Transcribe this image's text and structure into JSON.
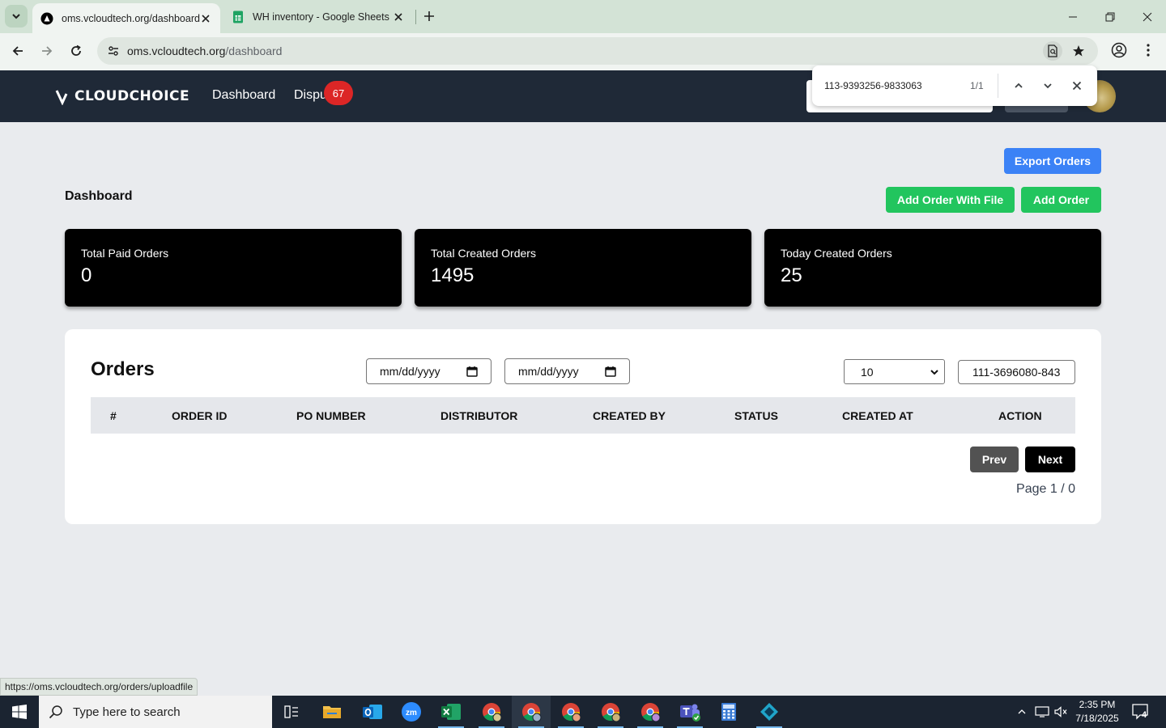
{
  "browser": {
    "tabs": [
      {
        "title": "oms.vcloudtech.org/dashboard",
        "active": true
      },
      {
        "title": "WH inventory - Google Sheets",
        "active": false
      }
    ],
    "url": {
      "host": "oms.vcloudtech.org",
      "path": "/dashboard"
    },
    "find": {
      "query": "113-9393256-9833063",
      "count": "1/1"
    },
    "status_url": "https://oms.vcloudtech.org/orders/uploadfile"
  },
  "navbar": {
    "brand": "CLOUDCHOICE",
    "links": [
      {
        "label": "Dashboard"
      },
      {
        "label": "Dispu"
      }
    ],
    "dispute_badge": "67"
  },
  "page": {
    "title": "Dashboard",
    "buttons": {
      "export": "Export Orders",
      "add_with_file": "Add Order With File",
      "add": "Add Order"
    },
    "stats": [
      {
        "label": "Total Paid Orders",
        "value": "0"
      },
      {
        "label": "Total Created Orders",
        "value": "1495"
      },
      {
        "label": "Today Created Orders",
        "value": "25"
      }
    ]
  },
  "orders": {
    "title": "Orders",
    "date_from_placeholder": "mm/dd/yyyy",
    "date_to_placeholder": "mm/dd/yyyy",
    "page_size": "10",
    "search_value": "111-3696080-843",
    "columns": [
      "#",
      "ORDER ID",
      "PO NUMBER",
      "DISTRIBUTOR",
      "CREATED BY",
      "STATUS",
      "CREATED AT",
      "ACTION"
    ],
    "rows": [],
    "prev_label": "Prev",
    "next_label": "Next",
    "page_info": "Page 1 / 0"
  },
  "taskbar": {
    "search_placeholder": "Type here to search",
    "time": "2:35 PM",
    "date": "7/18/2025",
    "notification_count": "4",
    "apps": [
      "task-view-icon",
      "file-explorer-icon",
      "outlook-icon",
      "zoom-icon",
      "excel-icon",
      "chrome-icon",
      "chrome-icon",
      "chrome-icon",
      "chrome-icon",
      "chrome-icon",
      "teams-icon",
      "calculator-icon",
      "app-icon"
    ]
  },
  "colors": {
    "navbar": "#1f2937",
    "export_button": "#3b82f6",
    "add_buttons": "#22c55e",
    "badge": "#dc2626",
    "stat_card": "#000000",
    "prev_button": "#525252",
    "next_button": "#000000"
  }
}
